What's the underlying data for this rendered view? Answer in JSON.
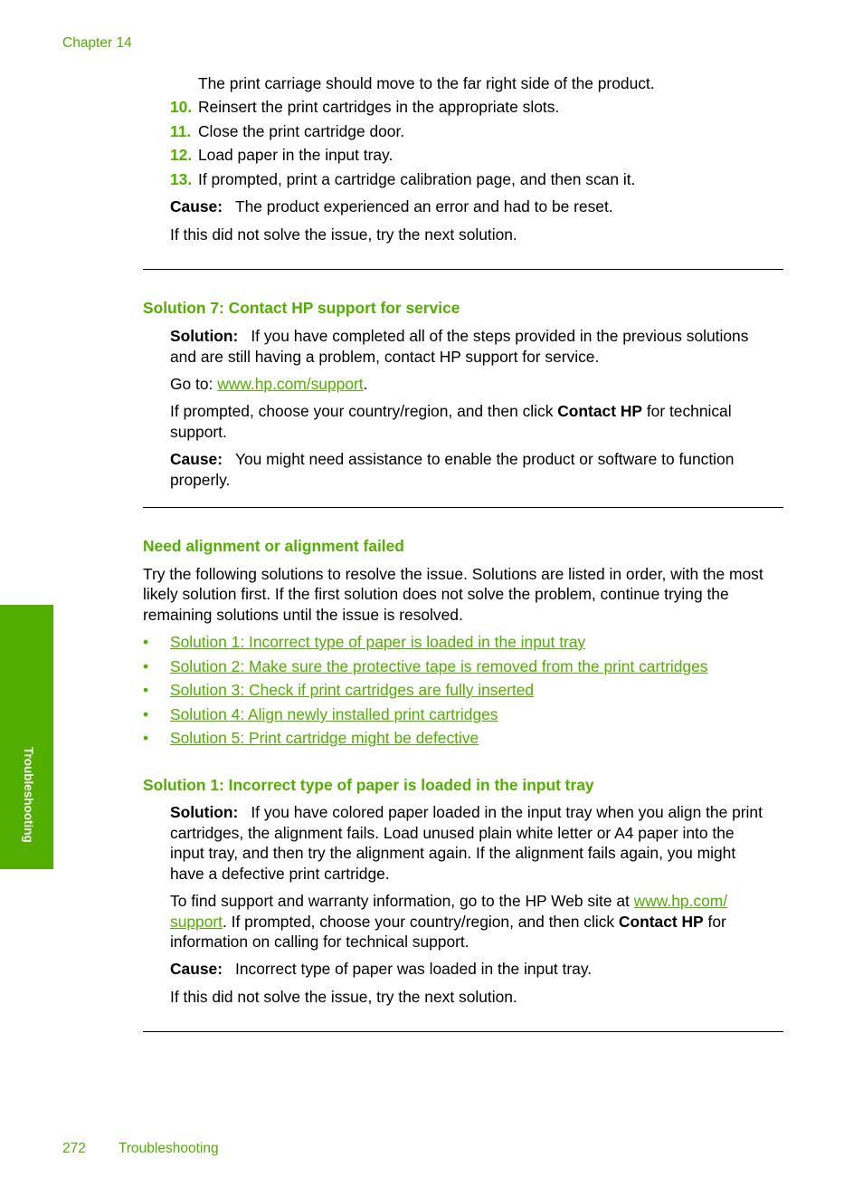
{
  "header": {
    "chapter": "Chapter 14"
  },
  "side_tab": {
    "label": "Troubleshooting"
  },
  "footer": {
    "page_number": "272",
    "section": "Troubleshooting"
  },
  "top_section": {
    "continuation": "The print carriage should move to the far right side of the product.",
    "steps": [
      {
        "num": "10.",
        "text": "Reinsert the print cartridges in the appropriate slots."
      },
      {
        "num": "11.",
        "text": "Close the print cartridge door."
      },
      {
        "num": "12.",
        "text": "Load paper in the input tray."
      },
      {
        "num": "13.",
        "text": "If prompted, print a cartridge calibration page, and then scan it."
      }
    ],
    "cause_label": "Cause:",
    "cause_text": "The product experienced an error and had to be reset.",
    "next": "If this did not solve the issue, try the next solution."
  },
  "solution7": {
    "heading": "Solution 7: Contact HP support for service",
    "solution_label": "Solution:",
    "solution_line1": "If you have completed all of the steps provided in the previous solutions",
    "solution_line2": "and are still having a problem, contact HP support for service.",
    "goto_prefix": "Go to: ",
    "goto_link": "www.hp.com/support",
    "goto_suffix": ".",
    "prompt_line1_pre": "If prompted, choose your country/region, and then click ",
    "prompt_bold": "Contact HP",
    "prompt_line1_post": " for technical",
    "prompt_line2": "support.",
    "cause_label": "Cause:",
    "cause_line1": "You might need assistance to enable the product or software to function",
    "cause_line2": "properly."
  },
  "alignment": {
    "heading": "Need alignment or alignment failed",
    "intro_line1": "Try the following solutions to resolve the issue. Solutions are listed in order, with the most",
    "intro_line2": "likely solution first. If the first solution does not solve the problem, continue trying the",
    "intro_line3": "remaining solutions until the issue is resolved.",
    "bullet_glyph": "•",
    "links": [
      "Solution 1: Incorrect type of paper is loaded in the input tray",
      "Solution 2: Make sure the protective tape is removed from the print cartridges",
      "Solution 3: Check if print cartridges are fully inserted",
      "Solution 4: Align newly installed print cartridges",
      "Solution 5: Print cartridge might be defective"
    ]
  },
  "solution1": {
    "heading": "Solution 1: Incorrect type of paper is loaded in the input tray",
    "solution_label": "Solution:",
    "solution_line1": "If you have colored paper loaded in the input tray when you align the print",
    "solution_line2": "cartridges, the alignment fails. Load unused plain white letter or A4 paper into the",
    "solution_line3": "input tray, and then try the alignment again. If the alignment fails again, you might",
    "solution_line4": "have a defective print cartridge.",
    "support_line1_pre": "To find support and warranty information, go to the HP Web site at ",
    "support_link_part1": "www.hp.com/",
    "support_link_part2": "support",
    "support_line2_post_pre": ". If prompted, choose your country/region, and then click ",
    "support_bold": "Contact HP",
    "support_line2_post": " for",
    "support_line3": "information on calling for technical support.",
    "cause_label": "Cause:",
    "cause_text": "Incorrect type of paper was loaded in the input tray.",
    "next": "If this did not solve the issue, try the next solution."
  },
  "colors": {
    "accent_green": "#52ae00",
    "text": "#000000"
  }
}
